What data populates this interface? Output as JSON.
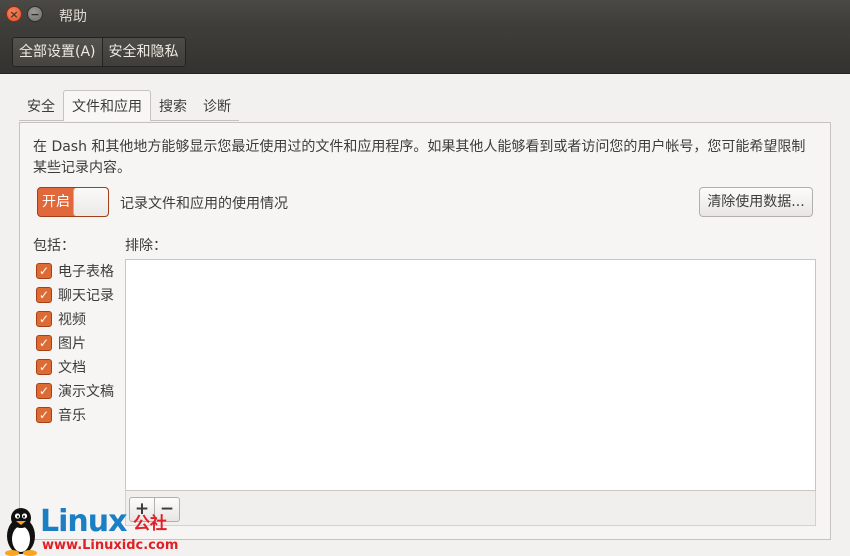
{
  "window": {
    "title": "帮助",
    "close_icon_glyph": "×",
    "minimize_icon_glyph": "−"
  },
  "breadcrumb": {
    "items": [
      "全部设置(A)",
      "安全和隐私"
    ]
  },
  "tabs": [
    {
      "label": "安全",
      "active": false
    },
    {
      "label": "文件和应用",
      "active": true
    },
    {
      "label": "搜索",
      "active": false
    },
    {
      "label": "诊断",
      "active": false
    }
  ],
  "files_apps": {
    "description": "在 Dash 和其他地方能够显示您最近使用过的文件和应用程序。如果其他人能够看到或者访问您的用户帐号，您可能希望限制某些记录内容。",
    "switch": {
      "state_label": "开启",
      "on": true
    },
    "switch_label": "记录文件和应用的使用情况",
    "clear_button": "清除使用数据...",
    "include_label": "包括：",
    "exclude_label": "排除：",
    "include_items": [
      {
        "label": "电子表格",
        "checked": true
      },
      {
        "label": "聊天记录",
        "checked": true
      },
      {
        "label": "视频",
        "checked": true
      },
      {
        "label": "图片",
        "checked": true
      },
      {
        "label": "文档",
        "checked": true
      },
      {
        "label": "演示文稿",
        "checked": true
      },
      {
        "label": "音乐",
        "checked": true
      }
    ],
    "check_glyph": "✓",
    "add_button": "+",
    "remove_button": "−"
  },
  "watermark": {
    "logo_text": "Linux",
    "logo_suffix": "公社",
    "url": "www.Linuxidc.com"
  },
  "colors": {
    "accent": "#e1683a",
    "titlebar": "#3c3b37",
    "watermark_blue": "#1c7fc4",
    "watermark_red": "#e01f26"
  }
}
